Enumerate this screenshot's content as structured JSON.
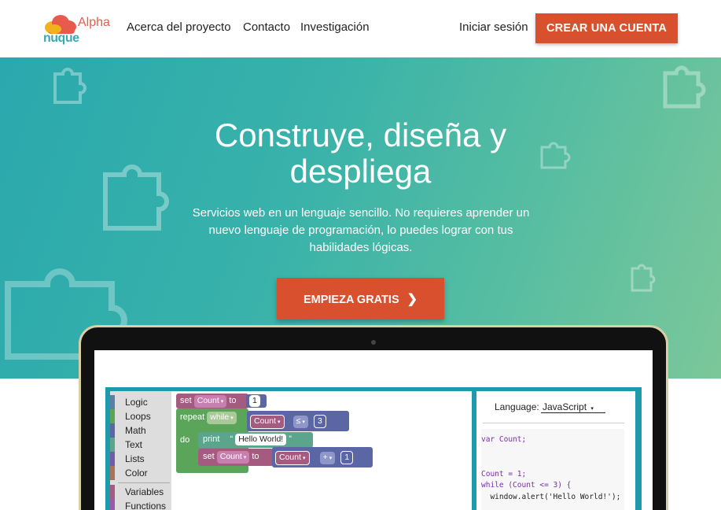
{
  "navbar": {
    "logo_text": "nuque",
    "logo_badge": "Alpha",
    "links": [
      "Acerca del proyecto",
      "Contacto",
      "Investigación"
    ],
    "login": "Iniciar sesión",
    "create_account": "CREAR UNA CUENTA"
  },
  "hero": {
    "title_line1": "Construye, diseña y",
    "title_line2": "despliega",
    "subtitle_line1": "Servicios web en un lenguaje sencillo. No requieres aprender un",
    "subtitle_line2": "nuevo lenguaje de programación, lo puedes lograr con tus",
    "subtitle_line3": "habilidades lógicas.",
    "cta": "EMPIEZA GRATIS",
    "cta_icon": "chevron-right-icon"
  },
  "editor": {
    "toolbox": [
      {
        "label": "Logic",
        "color": "#5b80a5"
      },
      {
        "label": "Loops",
        "color": "#5ba55b"
      },
      {
        "label": "Math",
        "color": "#5b67a5"
      },
      {
        "label": "Text",
        "color": "#5ba58c"
      },
      {
        "label": "Lists",
        "color": "#745ba5"
      },
      {
        "label": "Color",
        "color": "#a5745b"
      },
      {
        "label": "Variables",
        "color": "#a55b80"
      },
      {
        "label": "Functions",
        "color": "#995ba5"
      }
    ],
    "blocks": {
      "set_kw": "set",
      "to_kw": "to",
      "var_name": "Count",
      "init_value": "1",
      "repeat_kw": "repeat",
      "while_kw": "while",
      "compare_op": "≤",
      "limit_value": "3",
      "do_kw": "do",
      "print_kw": "print",
      "quote_open": "“",
      "quote_close": "”",
      "message": "Hello World!",
      "plus_op": "+",
      "increment": "1"
    },
    "language_label": "Language:",
    "language_value": "JavaScript",
    "code_lines": [
      "var Count;",
      "",
      "",
      "Count = 1;",
      "while (Count <= 3) {",
      "  window.alert('Hello World!');"
    ]
  },
  "colors": {
    "accent": "#d9502e",
    "hero_start": "#2aa8ad",
    "hero_end": "#7cc79a",
    "frame": "#1e9aab"
  }
}
